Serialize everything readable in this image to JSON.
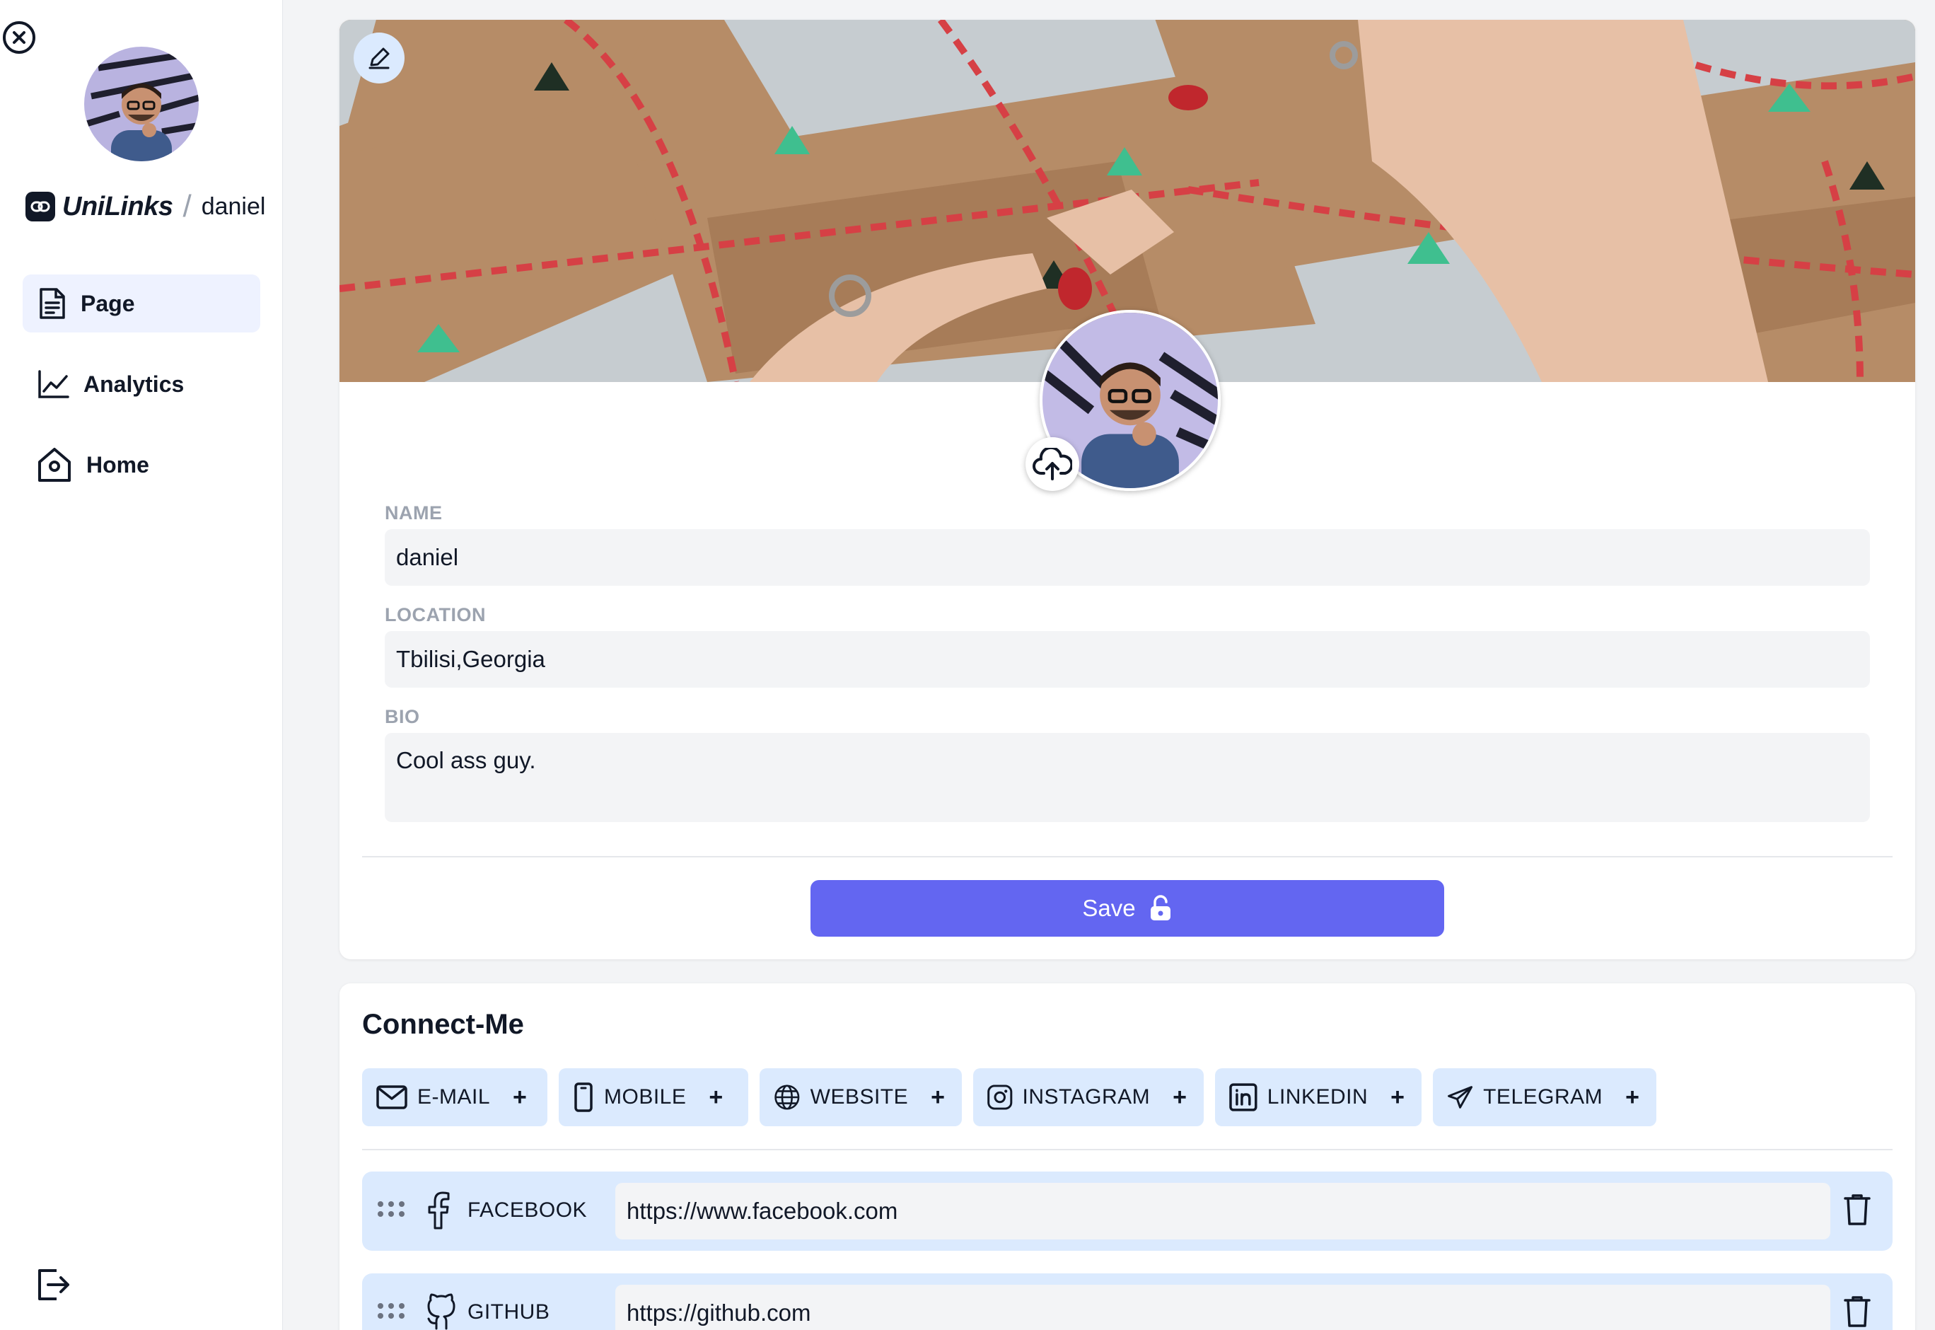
{
  "sidebar": {
    "brand": {
      "name": "UniLinks",
      "separator": "/",
      "username": "daniel"
    },
    "nav": [
      {
        "label": "Page",
        "icon": "page-icon",
        "active": true
      },
      {
        "label": "Analytics",
        "icon": "analytics-icon",
        "active": false
      },
      {
        "label": "Home",
        "icon": "home-icon",
        "active": false
      }
    ]
  },
  "profile": {
    "name_label": "NAME",
    "name_value": "daniel",
    "location_label": "LOCATION",
    "location_value": "Tbilisi,Georgia",
    "bio_label": "BIO",
    "bio_value": "Cool ass guy.",
    "save_label": "Save"
  },
  "connect": {
    "title": "Connect-Me",
    "chips": [
      {
        "label": "E-MAIL",
        "icon": "mail-icon"
      },
      {
        "label": "MOBILE",
        "icon": "mobile-icon"
      },
      {
        "label": "WEBSITE",
        "icon": "globe-icon"
      },
      {
        "label": "INSTAGRAM",
        "icon": "instagram-icon"
      },
      {
        "label": "LINKEDIN",
        "icon": "linkedin-icon"
      },
      {
        "label": "TELEGRAM",
        "icon": "telegram-icon"
      }
    ],
    "chip_plus": "+",
    "links": [
      {
        "label": "FACEBOOK",
        "icon": "facebook-icon",
        "url": "https://www.facebook.com"
      },
      {
        "label": "GITHUB",
        "icon": "github-icon",
        "url": "https://github.com"
      }
    ]
  },
  "colors": {
    "accent": "#6366f1",
    "chip_bg": "#dbeafe",
    "field_bg": "#f3f4f6",
    "page_bg": "#f3f4f6"
  }
}
